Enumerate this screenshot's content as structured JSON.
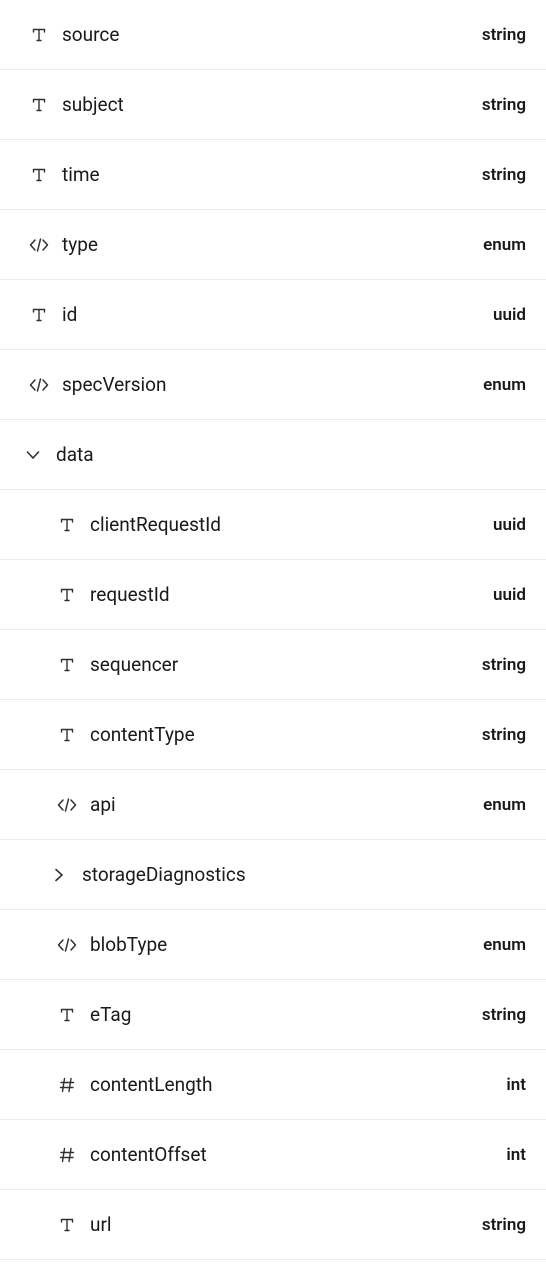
{
  "rows": [
    {
      "icon": "text",
      "name": "source",
      "type": "string",
      "level": 0,
      "branch": false,
      "expanded": null
    },
    {
      "icon": "text",
      "name": "subject",
      "type": "string",
      "level": 0,
      "branch": false,
      "expanded": null
    },
    {
      "icon": "text",
      "name": "time",
      "type": "string",
      "level": 0,
      "branch": false,
      "expanded": null
    },
    {
      "icon": "code",
      "name": "type",
      "type": "enum",
      "level": 0,
      "branch": false,
      "expanded": null
    },
    {
      "icon": "text",
      "name": "id",
      "type": "uuid",
      "level": 0,
      "branch": false,
      "expanded": null
    },
    {
      "icon": "code",
      "name": "specVersion",
      "type": "enum",
      "level": 0,
      "branch": false,
      "expanded": null
    },
    {
      "icon": "chevron",
      "name": "data",
      "type": "",
      "level": 0,
      "branch": true,
      "expanded": true
    },
    {
      "icon": "text",
      "name": "clientRequestId",
      "type": "uuid",
      "level": 1,
      "branch": false,
      "expanded": null
    },
    {
      "icon": "text",
      "name": "requestId",
      "type": "uuid",
      "level": 1,
      "branch": false,
      "expanded": null
    },
    {
      "icon": "text",
      "name": "sequencer",
      "type": "string",
      "level": 1,
      "branch": false,
      "expanded": null
    },
    {
      "icon": "text",
      "name": "contentType",
      "type": "string",
      "level": 1,
      "branch": false,
      "expanded": null
    },
    {
      "icon": "code",
      "name": "api",
      "type": "enum",
      "level": 1,
      "branch": false,
      "expanded": null
    },
    {
      "icon": "chevron",
      "name": "storageDiagnostics",
      "type": "",
      "level": 1,
      "branch": true,
      "expanded": false
    },
    {
      "icon": "code",
      "name": "blobType",
      "type": "enum",
      "level": 1,
      "branch": false,
      "expanded": null
    },
    {
      "icon": "text",
      "name": "eTag",
      "type": "string",
      "level": 1,
      "branch": false,
      "expanded": null
    },
    {
      "icon": "hash",
      "name": "contentLength",
      "type": "int",
      "level": 1,
      "branch": false,
      "expanded": null
    },
    {
      "icon": "hash",
      "name": "contentOffset",
      "type": "int",
      "level": 1,
      "branch": false,
      "expanded": null
    },
    {
      "icon": "text",
      "name": "url",
      "type": "string",
      "level": 1,
      "branch": false,
      "expanded": null
    }
  ]
}
